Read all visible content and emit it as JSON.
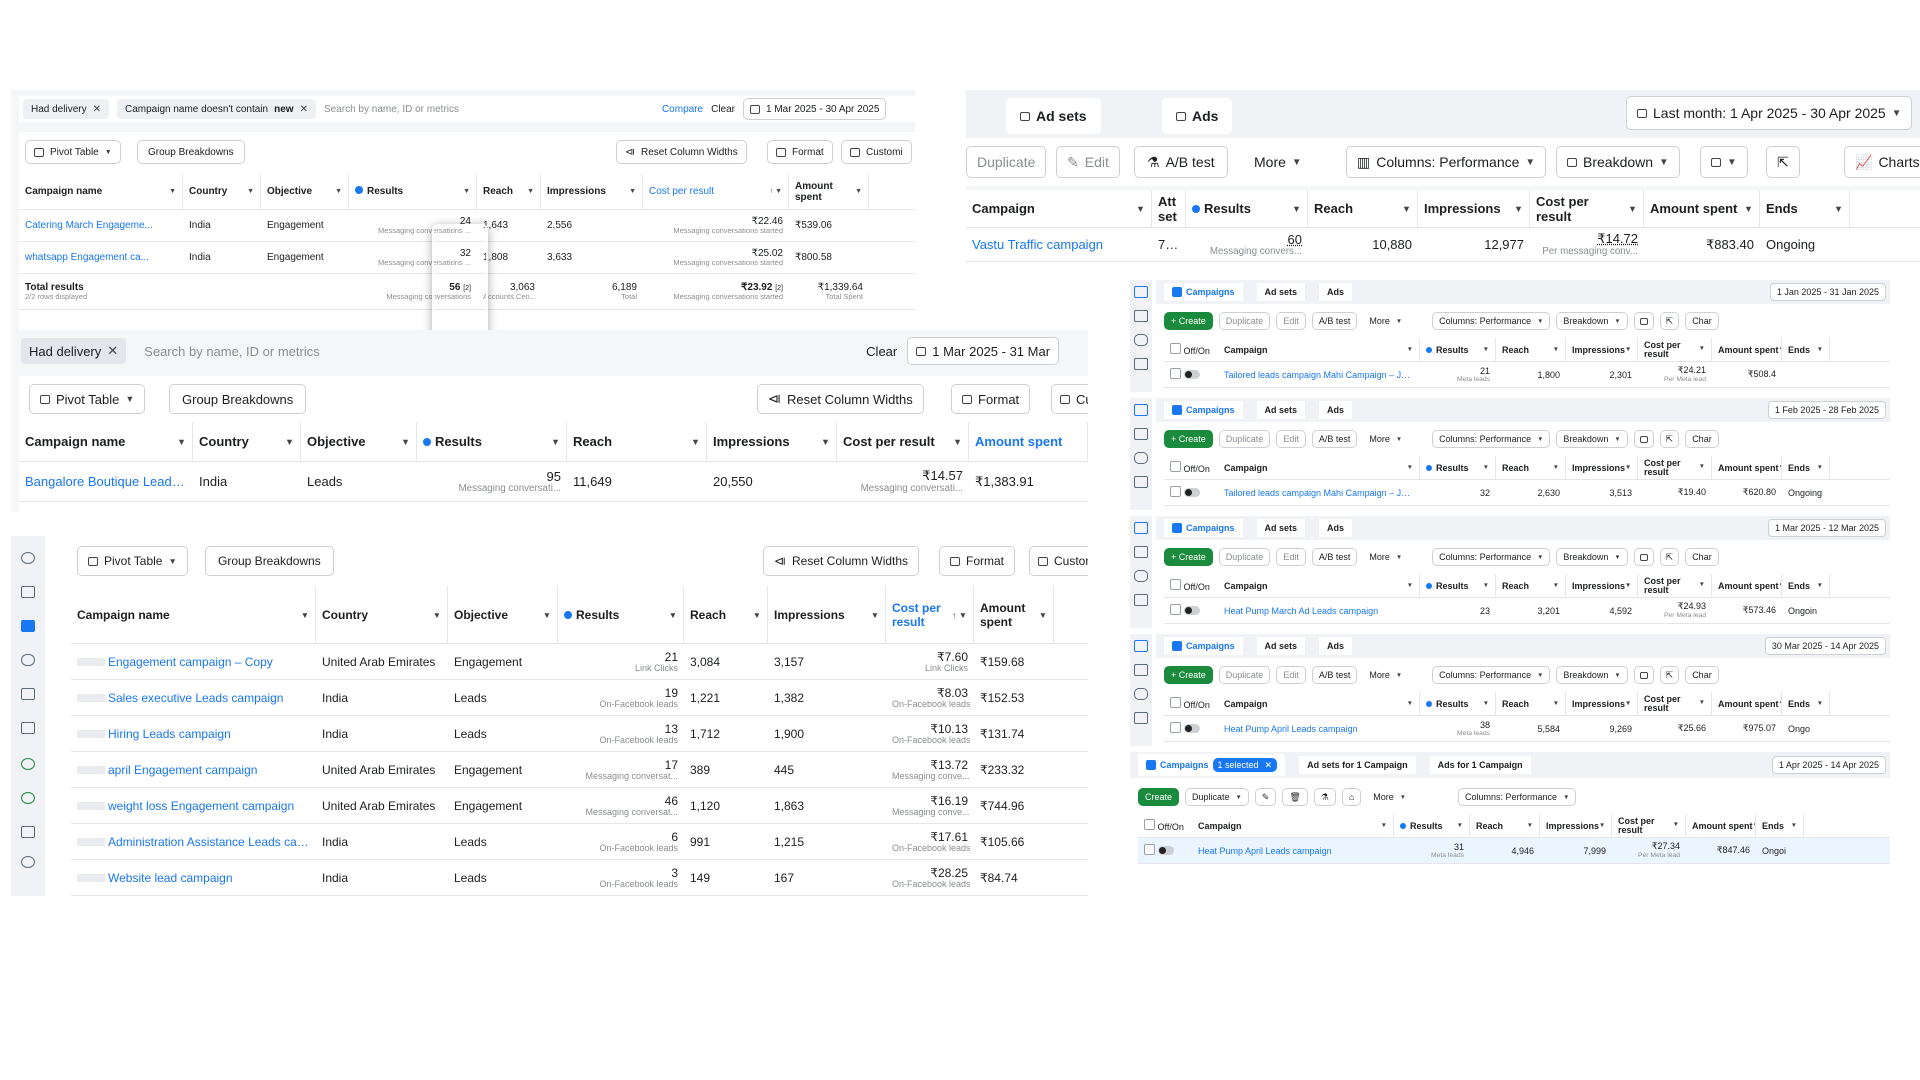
{
  "p1": {
    "chips": [
      "Had delivery",
      "Campaign name doesn't contain ",
      "new"
    ],
    "search": "Search by name, ID or metrics",
    "compare": "Compare",
    "clear": "Clear",
    "date": "1 Mar 2025 - 30 Apr 2025",
    "pivot": "Pivot Table",
    "group": "Group Breakdowns",
    "reset": "Reset Column Widths",
    "format": "Format",
    "custom": "Customi",
    "headers": [
      "Campaign name",
      "Country",
      "Objective",
      "Results",
      "Reach",
      "Impressions",
      "Cost per result",
      "Amount spent"
    ],
    "rows": [
      {
        "name": "Catering March Engageme...",
        "country": "India",
        "objective": "Engagement",
        "results": "24",
        "results_sub": "Messaging conversations ...",
        "reach": "1,643",
        "impr": "2,556",
        "cpr": "₹22.46",
        "cpr_sub": "Messaging conversations started",
        "spent": "₹539.06"
      },
      {
        "name": "whatsapp Engagement ca...",
        "country": "India",
        "objective": "Engagement",
        "results": "32",
        "results_sub": "Messaging conversations ...",
        "reach": "1,808",
        "impr": "3,633",
        "cpr": "₹25.02",
        "cpr_sub": "Messaging conversations started",
        "spent": "₹800.58"
      }
    ],
    "total": {
      "label": "Total results",
      "sub": "2/2 rows displayed",
      "results": "56",
      "results_tag": "[2]",
      "results_sub": "Messaging conversations",
      "reach": "3,063",
      "reach_sub": "Accounts Cen...",
      "impr": "6,189",
      "impr_sub": "Total",
      "cpr": "₹23.92",
      "cpr_tag": "[2]",
      "cpr_sub": "Messaging conversations started",
      "spent": "₹1,339.64",
      "spent_sub": "Total Spent"
    }
  },
  "p2": {
    "chip": "Had delivery",
    "search": "Search by name, ID or metrics",
    "clear": "Clear",
    "date": "1 Mar 2025 - 31 Mar",
    "pivot": "Pivot Table",
    "group": "Group Breakdowns",
    "reset": "Reset Column Widths",
    "format": "Format",
    "cu": "Cu",
    "headers": [
      "Campaign name",
      "Country",
      "Objective",
      "Results",
      "Reach",
      "Impressions",
      "Cost per result",
      "Amount spent"
    ],
    "row": {
      "name": "Bangalore Boutique Leads ...",
      "country": "India",
      "objective": "Leads",
      "results": "95",
      "results_sub": "Messaging conversati...",
      "reach": "11,649",
      "impr": "20,550",
      "cpr": "₹14.57",
      "cpr_sub": "Messaging conversati...",
      "spent": "₹1,383.91"
    }
  },
  "p3": {
    "pivot": "Pivot Table",
    "group": "Group Breakdowns",
    "reset": "Reset Column Widths",
    "format": "Format",
    "custom": "Customi",
    "headers": [
      "Campaign name",
      "Country",
      "Objective",
      "Results",
      "Reach",
      "Impressions",
      "Cost per result",
      "Amount spent"
    ],
    "rows": [
      {
        "name": "Engagement campaign – Copy",
        "country": "United Arab Emirates",
        "objective": "Engagement",
        "results": "21",
        "results_sub": "Link Clicks",
        "reach": "3,084",
        "impr": "3,157",
        "cpr": "₹7.60",
        "cpr_sub": "Link Clicks",
        "spent": "₹159.68"
      },
      {
        "name": "Sales executive Leads campaign",
        "country": "India",
        "objective": "Leads",
        "results": "19",
        "results_sub": "On-Facebook leads",
        "reach": "1,221",
        "impr": "1,382",
        "cpr": "₹8.03",
        "cpr_sub": "On-Facebook leads",
        "spent": "₹152.53"
      },
      {
        "name": "Hiring Leads campaign",
        "country": "India",
        "objective": "Leads",
        "results": "13",
        "results_sub": "On-Facebook leads",
        "reach": "1,712",
        "impr": "1,900",
        "cpr": "₹10.13",
        "cpr_sub": "On-Facebook leads",
        "spent": "₹131.74"
      },
      {
        "name": "april Engagement campaign",
        "country": "United Arab Emirates",
        "objective": "Engagement",
        "results": "17",
        "results_sub": "Messaging conversat...",
        "reach": "389",
        "impr": "445",
        "cpr": "₹13.72",
        "cpr_sub": "Messaging conve...",
        "spent": "₹233.32"
      },
      {
        "name": "weight loss Engagement campaign",
        "country": "United Arab Emirates",
        "objective": "Engagement",
        "results": "46",
        "results_sub": "Messaging conversat...",
        "reach": "1,120",
        "impr": "1,863",
        "cpr": "₹16.19",
        "cpr_sub": "Messaging conve...",
        "spent": "₹744.96"
      },
      {
        "name": "Administration Assistance Leads campaign",
        "country": "India",
        "objective": "Leads",
        "results": "6",
        "results_sub": "On-Facebook leads",
        "reach": "991",
        "impr": "1,215",
        "cpr": "₹17.61",
        "cpr_sub": "On-Facebook leads",
        "spent": "₹105.66"
      },
      {
        "name": "Website lead campaign",
        "country": "India",
        "objective": "Leads",
        "results": "3",
        "results_sub": "On-Facebook leads",
        "reach": "149",
        "impr": "167",
        "cpr": "₹28.25",
        "cpr_sub": "On-Facebook leads",
        "spent": "₹84.74"
      }
    ]
  },
  "p4": {
    "tabs": [
      "Ad sets",
      "Ads"
    ],
    "date": "Last month: 1 Apr 2025 - 30 Apr 2025",
    "duplicate": "Duplicate",
    "edit": "Edit",
    "ab": "A/B test",
    "more": "More",
    "columns": "Columns: Performance",
    "breakdown": "Breakdown",
    "charts": "Charts",
    "headers": [
      "Campaign",
      "Att set",
      "Results",
      "Reach",
      "Impressions",
      "Cost per result",
      "Amount spent",
      "Ends"
    ],
    "row": {
      "name": "Vastu Traffic campaign",
      "att": "7-...",
      "results": "60",
      "results_sub": "Messaging convers...",
      "reach": "10,880",
      "impr": "12,977",
      "cpr": "₹14.72",
      "cpr_sub": "Per messaging conv...",
      "spent": "₹883.40",
      "ends": "Ongoing"
    }
  },
  "mini": [
    {
      "date": "1 Jan 2025 - 31 Jan 2025",
      "name": "Tailored leads campaign Mahi Campaign – January Campaign...",
      "results": "21",
      "results_sub": "Meta leads",
      "reach": "1,800",
      "impr": "2,301",
      "cpr": "₹24.21",
      "cpr_sub": "Per Meta lead",
      "spent": "₹508.4",
      "ends": ""
    },
    {
      "date": "1 Feb 2025 - 28 Feb 2025",
      "name": "Tailored leads campaign Mahi Campaign – Jan...",
      "results": "32",
      "results_sub": "",
      "reach": "2,630",
      "impr": "3,513",
      "cpr": "₹19.40",
      "cpr_sub": "",
      "spent": "₹620.80",
      "ends": "Ongoing"
    },
    {
      "date": "1 Mar 2025 - 12 Mar 2025",
      "name": "Heat Pump March Ad Leads campaign",
      "results": "23",
      "results_sub": "",
      "reach": "3,201",
      "impr": "4,592",
      "cpr": "₹24.93",
      "cpr_sub": "Per Meta lead",
      "spent": "₹573.46",
      "ends": "Ongoin"
    },
    {
      "date": "30 Mar 2025 - 14 Apr 2025",
      "name": "Heat Pump April Leads campaign",
      "results": "38",
      "results_sub": "Meta leads",
      "reach": "5,584",
      "impr": "9,269",
      "cpr": "₹25.66",
      "cpr_sub": "",
      "spent": "₹975.07",
      "ends": "Ongo"
    }
  ],
  "mini_labels": {
    "campaigns": "Campaigns",
    "adsets": "Ad sets",
    "ads": "Ads",
    "create": "+ Create",
    "duplicate": "Duplicate",
    "edit": "Edit",
    "ab": "A/B test",
    "more": "More",
    "columns": "Columns: Performance",
    "breakdown": "Breakdown",
    "charts": "Char",
    "charts_full": "Charts",
    "offon": "Off/On",
    "campaign": "Campaign",
    "results": "Results",
    "reach": "Reach",
    "impr": "Impressions",
    "cpr": "Cost per result",
    "spent": "Amount spent",
    "ends": "Ends"
  },
  "last": {
    "campaigns": "Campaigns",
    "selected": "1 selected",
    "adsets": "Ad sets for 1 Campaign",
    "ads": "Ads for 1 Campaign",
    "date": "1 Apr 2025 - 14 Apr 2025",
    "create": "Create",
    "duplicate": "Duplicate",
    "more": "More",
    "columns": "Columns: Performance",
    "row": {
      "name": "Heat Pump April Leads campaign",
      "results": "31",
      "results_sub": "Meta leads",
      "reach": "4,946",
      "impr": "7,999",
      "cpr": "₹27.34",
      "cpr_sub": "Per Meta lead",
      "spent": "₹847.46",
      "ends": "Ongoi"
    }
  },
  "colors": {
    "link": "#1877f2",
    "create": "#1a8a3c",
    "border": "#ccd0d5"
  }
}
